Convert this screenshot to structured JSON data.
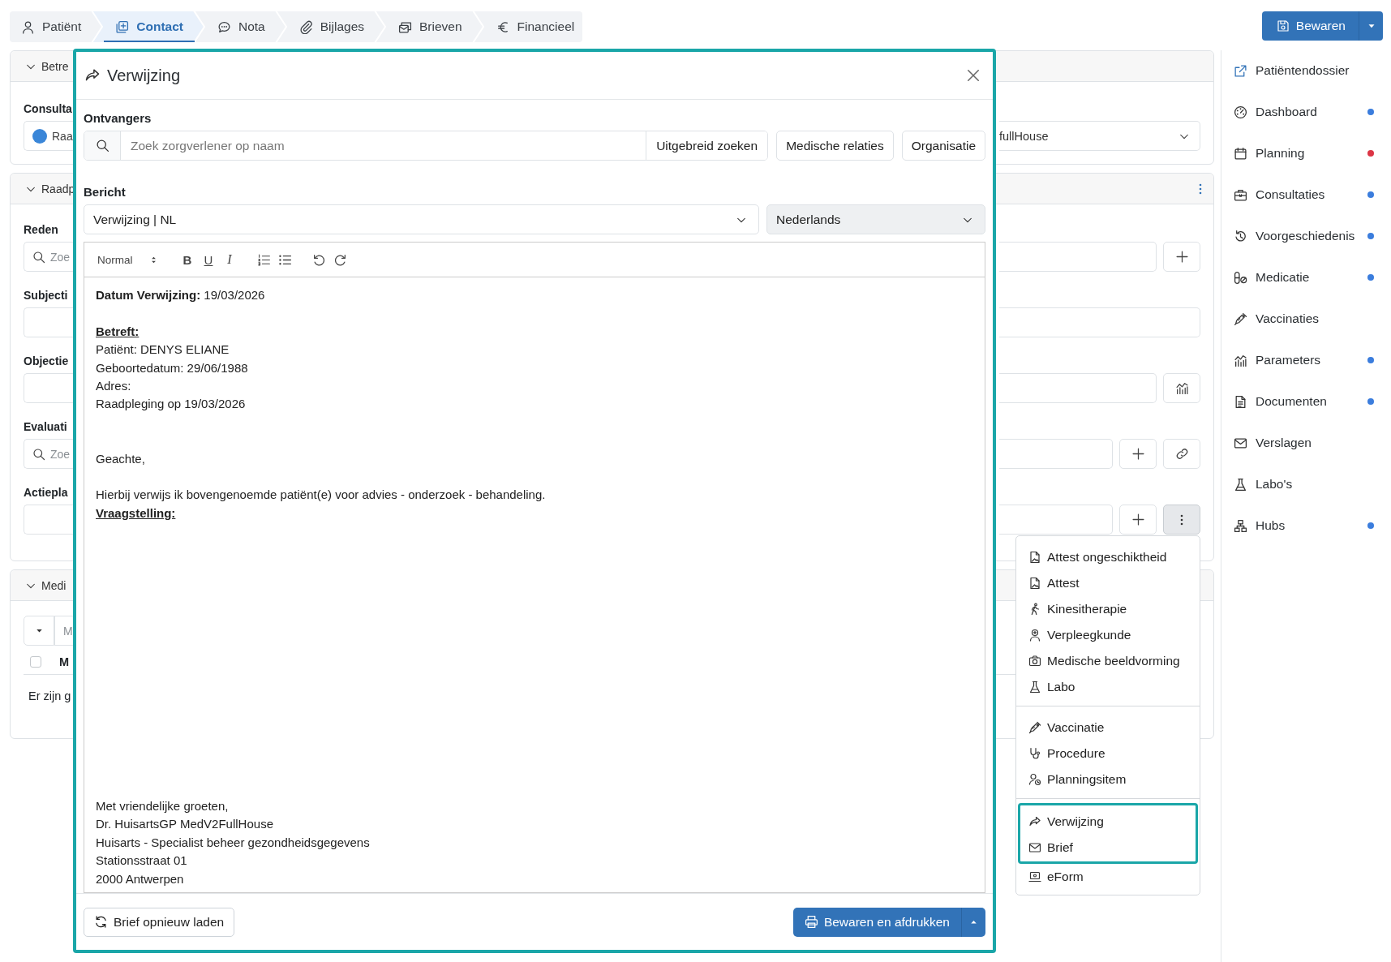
{
  "tabs": [
    {
      "label": "Patiënt",
      "selected": false
    },
    {
      "label": "Contact",
      "selected": true
    },
    {
      "label": "Nota",
      "selected": false
    },
    {
      "label": "Bijlages",
      "selected": false
    },
    {
      "label": "Brieven",
      "selected": false
    },
    {
      "label": "Financieel",
      "selected": false
    }
  ],
  "save_button": {
    "label": "Bewaren"
  },
  "background": {
    "panels": [
      {
        "title": "Betre",
        "kind": "consult",
        "label": "Consulta",
        "value": "Raa",
        "value_tail": "fullHouse"
      },
      {
        "title": "Raadp",
        "kind": "form",
        "groups": [
          {
            "label": "Reden",
            "kind": "search",
            "placeholder": "Zoe",
            "actions": [
              {
                "kind": "plus",
                "pressed": false
              }
            ]
          },
          {
            "label": "Subjecti",
            "kind": "text"
          },
          {
            "label": "Objectie",
            "kind": "text",
            "actions": [
              {
                "kind": "chart",
                "pressed": false
              }
            ]
          },
          {
            "label": "Evaluati",
            "kind": "search",
            "placeholder": "Zoe",
            "actions": [
              {
                "kind": "plus",
                "pressed": false
              },
              {
                "kind": "link",
                "pressed": false
              }
            ]
          },
          {
            "label": "Actiepla",
            "kind": "text",
            "actions": [
              {
                "kind": "plus",
                "pressed": false
              },
              {
                "kind": "more",
                "pressed": true
              }
            ]
          }
        ]
      },
      {
        "title": "Medi",
        "kind": "medication",
        "filter_placeholder": "M",
        "column": "M",
        "checked": false,
        "empty_text": "Er zijn g"
      }
    ]
  },
  "sidebar": {
    "items": [
      {
        "label": "Patiëntendossier"
      },
      {
        "label": "Dashboard",
        "color": "#3b7ddd"
      },
      {
        "label": "Planning",
        "color": "#dc3545"
      },
      {
        "label": "Consultaties",
        "color": "#3b7ddd"
      },
      {
        "label": "Voorgeschiedenis",
        "color": "#3b7ddd"
      },
      {
        "label": "Medicatie",
        "color": "#3b7ddd"
      },
      {
        "label": "Vaccinaties"
      },
      {
        "label": "Parameters",
        "color": "#3b7ddd"
      },
      {
        "label": "Documenten",
        "color": "#3b7ddd"
      },
      {
        "label": "Verslagen"
      },
      {
        "label": "Labo's"
      },
      {
        "label": "Hubs",
        "color": "#3b7ddd"
      }
    ]
  },
  "modal": {
    "title": "Verwijzing",
    "recipients_label": "Ontvangers",
    "search_placeholder": "Zoek zorgverlener op naam",
    "search_buttons": [
      "Uitgebreid zoeken",
      "Medische relaties",
      "Organisatie"
    ],
    "message_label": "Bericht",
    "template": "Verwijzing | NL",
    "language": "Nederlands",
    "toolbar": {
      "format": "Normal",
      "marks": [
        "B",
        "U",
        "I"
      ]
    },
    "body": [
      {
        "kind": "text",
        "text": "**Datum Verwijzing:** 19/03/2026"
      },
      {
        "kind": "blank"
      },
      {
        "kind": "heading",
        "text": "Betreft:"
      },
      {
        "kind": "text",
        "text": "Patiënt: DENYS ELIANE"
      },
      {
        "kind": "text",
        "text": "Geboortedatum: 29/06/1988"
      },
      {
        "kind": "text",
        "text": "Adres:"
      },
      {
        "kind": "text",
        "text": "Raadpleging op 19/03/2026"
      },
      {
        "kind": "blank"
      },
      {
        "kind": "blank"
      },
      {
        "kind": "text",
        "text": "Geachte,"
      },
      {
        "kind": "blank"
      },
      {
        "kind": "text",
        "text": "Hierbij verwijs ik bovengenoemde patiënt(e) voor advies - onderzoek - behandeling."
      },
      {
        "kind": "heading",
        "text": "Vraagstelling:"
      }
    ],
    "closing": [
      "Met vriendelijke groeten,",
      "Dr. HuisartsGP MedV2FullHouse",
      "Huisarts - Specialist beheer gezondheidsgegevens",
      "Stationsstraat 01",
      "2000 Antwerpen"
    ],
    "reload_button": "Brief opnieuw laden",
    "print_button": "Bewaren en afdrukken"
  },
  "menu": {
    "sections": [
      {
        "items": [
          {
            "label": "Attest ongeschiktheid",
            "highlighted": false
          },
          {
            "label": "Attest",
            "highlighted": false
          },
          {
            "label": "Kinesitherapie",
            "highlighted": false
          },
          {
            "label": "Verpleegkunde",
            "highlighted": false
          },
          {
            "label": "Medische beeldvorming",
            "highlighted": false
          },
          {
            "label": "Labo",
            "highlighted": false
          }
        ]
      },
      {
        "items": [
          {
            "label": "Vaccinatie",
            "highlighted": false
          },
          {
            "label": "Procedure",
            "highlighted": false
          },
          {
            "label": "Planningsitem",
            "highlighted": false
          }
        ]
      },
      {
        "items": [
          {
            "label": "Verwijzing",
            "highlighted": true
          },
          {
            "label": "Brief",
            "highlighted": true
          },
          {
            "label": "eForm",
            "highlighted": false
          }
        ]
      }
    ]
  }
}
